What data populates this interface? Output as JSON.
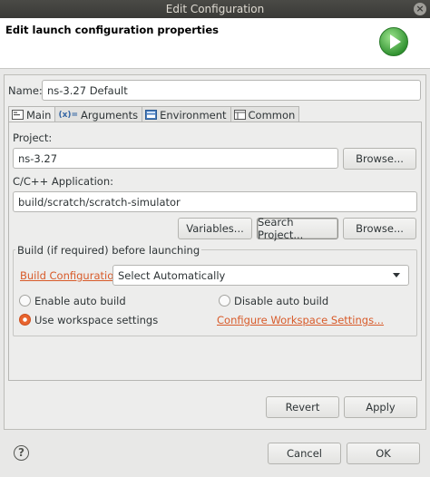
{
  "window": {
    "title": "Edit Configuration"
  },
  "header": {
    "title": "Edit launch configuration properties"
  },
  "name": {
    "label": "Name:",
    "value": "ns-3.27 Default"
  },
  "tabs": [
    {
      "label": "Main",
      "icon": "main-tab-icon"
    },
    {
      "label": "Arguments",
      "icon": "arguments-icon"
    },
    {
      "label": "Environment",
      "icon": "environment-icon"
    },
    {
      "label": "Common",
      "icon": "common-icon"
    }
  ],
  "main": {
    "project_label": "Project:",
    "project_value": "ns-3.27",
    "project_browse": "Browse...",
    "app_label": "C/C++ Application:",
    "app_value": "build/scratch/scratch-simulator",
    "variables": "Variables...",
    "search_project": "Search Project...",
    "app_browse": "Browse...",
    "build": {
      "group_title": "Build (if required) before launching",
      "config_link": "Build Configuration:",
      "config_value": "Select Automatically",
      "enable_auto": "Enable auto build",
      "disable_auto": "Disable auto build",
      "use_workspace": "Use workspace settings",
      "configure_link": "Configure Workspace Settings...",
      "selected": "use_workspace"
    }
  },
  "actions": {
    "revert": "Revert",
    "apply": "Apply"
  },
  "footer": {
    "cancel": "Cancel",
    "ok": "OK",
    "help": "?"
  },
  "colors": {
    "link": "#d85b2a",
    "run_icon": "#3aa33a",
    "radio_accent": "#e8642e"
  }
}
